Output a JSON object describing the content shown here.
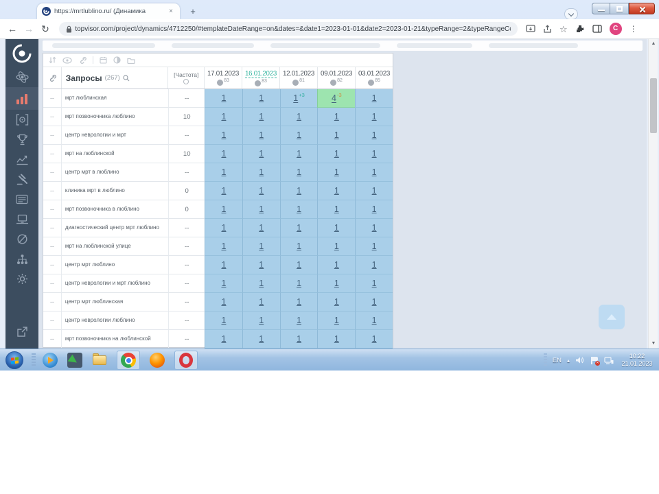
{
  "colors": {
    "accent_selected_date": "#35b5a0",
    "cell_blue": "#a9cfe9",
    "cell_green": "#9de4af",
    "sup_up": "#2fae9e",
    "sup_down": "#cf8a3d",
    "sidebar_active_icon": "#e87b6e",
    "avatar": "#e0447f"
  },
  "browser": {
    "tab_title": "https://mrtlublino.ru/ (Динамика",
    "tab_close": "×",
    "new_tab_plus": "+",
    "url": "topvisor.com/project/dynamics/4712250/#templateDateRange=on&dates=&date1=2023-01-01&date2=2023-01-21&typeRange=2&typeRangeCompare=7...",
    "bookmark_star": "☆",
    "menu_dots": "⋮",
    "profile_initial": "C",
    "back_arrow": "←",
    "forward_arrow": "→",
    "reload_arrow": "↻"
  },
  "sidebar": {
    "icons": [
      "topvisor-logo",
      "projects-atom-icon",
      "dynamics-bar-chart-icon",
      "positions-target-icon",
      "trophy-icon",
      "trend-chart-icon",
      "bids-gavel-icon",
      "snippets-cards-icon",
      "site-laptop-icon",
      "links-magnet-icon",
      "structure-sitemap-icon",
      "settings-gear-icon",
      "open-external-icon"
    ],
    "active_item": "dynamics-bar-chart-icon"
  },
  "table": {
    "toolbar_icons": [
      "sort-icon",
      "eye-icon",
      "link-icon",
      "calendar-icon",
      "contrast-icon",
      "folder-icon"
    ],
    "queries_label": "Запросы",
    "queries_count": "(267)",
    "frequency_label": "[Частота]",
    "row_link_placeholder": "--",
    "dates": [
      {
        "label": "17.01.2023",
        "count": "83",
        "selected": false
      },
      {
        "label": "16.01.2023",
        "count": "83",
        "selected": true
      },
      {
        "label": "12.01.2023",
        "count": "81",
        "selected": false
      },
      {
        "label": "09.01.2023",
        "count": "82",
        "selected": false
      },
      {
        "label": "03.01.2023",
        "count": "85",
        "selected": false
      }
    ],
    "rows": [
      {
        "keyword": "мрт люблинская",
        "frequency": "--",
        "cells": [
          {
            "v": "1"
          },
          {
            "v": "1"
          },
          {
            "v": "1",
            "sup": "+3",
            "dir": "up"
          },
          {
            "v": "4",
            "sup": "-3",
            "dir": "down",
            "green": true
          },
          {
            "v": "1"
          }
        ]
      },
      {
        "keyword": "мрт позвоночника люблино",
        "frequency": "10",
        "cells": [
          {
            "v": "1"
          },
          {
            "v": "1"
          },
          {
            "v": "1"
          },
          {
            "v": "1"
          },
          {
            "v": "1"
          }
        ]
      },
      {
        "keyword": "центр неврологии и мрт",
        "frequency": "--",
        "cells": [
          {
            "v": "1"
          },
          {
            "v": "1"
          },
          {
            "v": "1"
          },
          {
            "v": "1"
          },
          {
            "v": "1"
          }
        ]
      },
      {
        "keyword": "мрт на люблинской",
        "frequency": "10",
        "cells": [
          {
            "v": "1"
          },
          {
            "v": "1"
          },
          {
            "v": "1"
          },
          {
            "v": "1"
          },
          {
            "v": "1"
          }
        ]
      },
      {
        "keyword": "центр мрт в люблино",
        "frequency": "--",
        "cells": [
          {
            "v": "1"
          },
          {
            "v": "1"
          },
          {
            "v": "1"
          },
          {
            "v": "1"
          },
          {
            "v": "1"
          }
        ]
      },
      {
        "keyword": "клиника мрт в люблино",
        "frequency": "0",
        "cells": [
          {
            "v": "1"
          },
          {
            "v": "1"
          },
          {
            "v": "1"
          },
          {
            "v": "1"
          },
          {
            "v": "1"
          }
        ]
      },
      {
        "keyword": "мрт позвоночника в люблино",
        "frequency": "0",
        "cells": [
          {
            "v": "1"
          },
          {
            "v": "1"
          },
          {
            "v": "1"
          },
          {
            "v": "1"
          },
          {
            "v": "1"
          }
        ]
      },
      {
        "keyword": "диагностический центр мрт люблино",
        "frequency": "--",
        "cells": [
          {
            "v": "1"
          },
          {
            "v": "1"
          },
          {
            "v": "1"
          },
          {
            "v": "1"
          },
          {
            "v": "1"
          }
        ]
      },
      {
        "keyword": "мрт на люблинской улице",
        "frequency": "--",
        "cells": [
          {
            "v": "1"
          },
          {
            "v": "1"
          },
          {
            "v": "1"
          },
          {
            "v": "1"
          },
          {
            "v": "1"
          }
        ]
      },
      {
        "keyword": "центр мрт люблино",
        "frequency": "--",
        "cells": [
          {
            "v": "1"
          },
          {
            "v": "1"
          },
          {
            "v": "1"
          },
          {
            "v": "1"
          },
          {
            "v": "1"
          }
        ]
      },
      {
        "keyword": "центр неврологии и мрт люблино",
        "frequency": "--",
        "cells": [
          {
            "v": "1"
          },
          {
            "v": "1"
          },
          {
            "v": "1"
          },
          {
            "v": "1"
          },
          {
            "v": "1"
          }
        ]
      },
      {
        "keyword": "центр мрт люблинская",
        "frequency": "--",
        "cells": [
          {
            "v": "1"
          },
          {
            "v": "1"
          },
          {
            "v": "1"
          },
          {
            "v": "1"
          },
          {
            "v": "1"
          }
        ]
      },
      {
        "keyword": "центр неврологии люблино",
        "frequency": "--",
        "cells": [
          {
            "v": "1"
          },
          {
            "v": "1"
          },
          {
            "v": "1"
          },
          {
            "v": "1"
          },
          {
            "v": "1"
          }
        ]
      },
      {
        "keyword": "мрт позвоночника на люблинской",
        "frequency": "--",
        "cells": [
          {
            "v": "1"
          },
          {
            "v": "1"
          },
          {
            "v": "1"
          },
          {
            "v": "1"
          },
          {
            "v": "1"
          }
        ]
      }
    ]
  },
  "scroll": {
    "up_arrow": "▲",
    "down_arrow": "▼"
  },
  "taskbar": {
    "tray_language": "EN",
    "tray_expand_arrow": "▴",
    "clock_time": "10:22",
    "clock_date": "21.01.2023"
  }
}
